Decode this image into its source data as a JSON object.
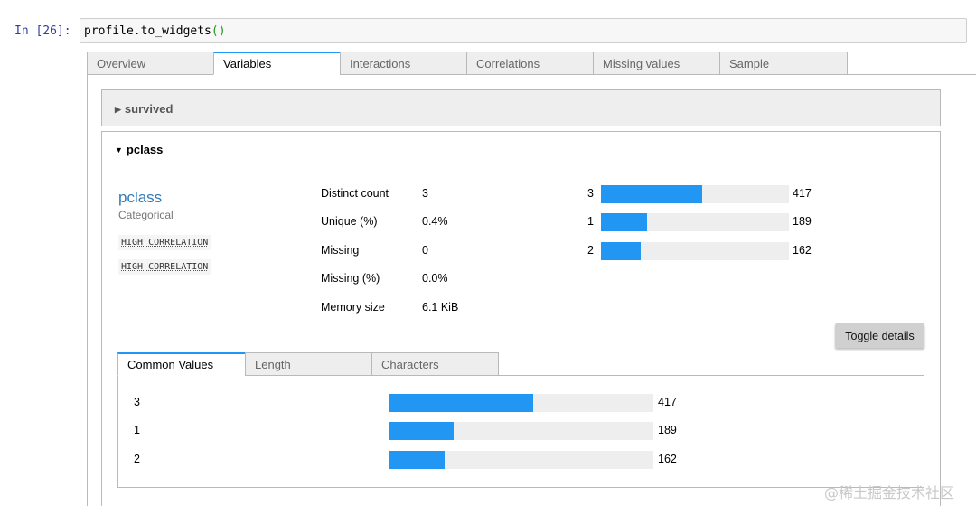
{
  "cell": {
    "prompt": "In [26]:",
    "code_main": "profile.to_widgets",
    "code_paren": "()"
  },
  "tabs": [
    "Overview",
    "Variables",
    "Interactions",
    "Correlations",
    "Missing values",
    "Sample"
  ],
  "active_tab": "Variables",
  "accordion": {
    "collapsed_title": "survived",
    "expanded_title": "pclass"
  },
  "variable": {
    "name": "pclass",
    "type": "Categorical",
    "badges": [
      "HIGH CORRELATION",
      "HIGH CORRELATION"
    ],
    "stats": [
      {
        "label": "Distinct count",
        "value": "3"
      },
      {
        "label": "Unique (%)",
        "value": "0.4%"
      },
      {
        "label": "Missing",
        "value": "0"
      },
      {
        "label": "Missing (%)",
        "value": "0.0%"
      },
      {
        "label": "Memory size",
        "value": "6.1 KiB"
      }
    ],
    "mini_frequencies": [
      {
        "label": "3",
        "count": "417",
        "fraction": 0.54
      },
      {
        "label": "1",
        "count": "189",
        "fraction": 0.245
      },
      {
        "label": "2",
        "count": "162",
        "fraction": 0.21
      }
    ],
    "toggle_label": "Toggle details"
  },
  "inner_tabs": [
    "Common Values",
    "Length",
    "Characters"
  ],
  "active_inner_tab": "Common Values",
  "common_values": [
    {
      "label": "3",
      "count": "417",
      "fraction": 0.545
    },
    {
      "label": "1",
      "count": "189",
      "fraction": 0.247
    },
    {
      "label": "2",
      "count": "162",
      "fraction": 0.212
    }
  ],
  "watermark": "@稀土掘金技术社区",
  "colors": {
    "accent": "#2196f3",
    "link": "#337ab7",
    "prompt": "#303f9f"
  }
}
